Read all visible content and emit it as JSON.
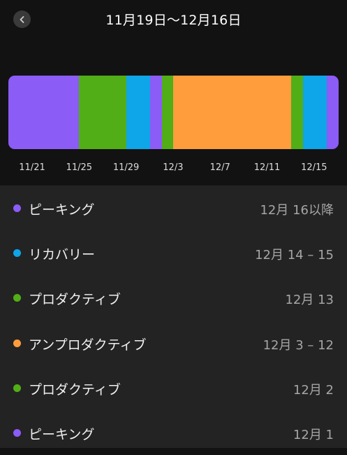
{
  "header": {
    "title": "11月19日～12月16日",
    "back_icon": "chevron-left-icon"
  },
  "colors": {
    "peaking": "#8b5cf6",
    "recovery": "#0ea5e9",
    "productive": "#52ae16",
    "unproductive": "#ff9d3d"
  },
  "timeline": {
    "segments": [
      {
        "state": "ピーキング",
        "color": "#8b5cf6",
        "days": 4.5
      },
      {
        "state": "プロダクティブ",
        "color": "#52ae16",
        "days": 3
      },
      {
        "state": "リカバリー",
        "color": "#0ea5e9",
        "days": 1.5
      },
      {
        "state": "ピーキング",
        "color": "#8b5cf6",
        "days": 0.75
      },
      {
        "state": "プロダクティブ",
        "color": "#52ae16",
        "days": 0.75
      },
      {
        "state": "アンプロダクティブ",
        "color": "#ff9d3d",
        "days": 7.5
      },
      {
        "state": "プロダクティブ",
        "color": "#52ae16",
        "days": 0.75
      },
      {
        "state": "リカバリー",
        "color": "#0ea5e9",
        "days": 1.5
      },
      {
        "state": "ピーキング",
        "color": "#8b5cf6",
        "days": 0.75
      }
    ],
    "axis_labels": [
      "11/21",
      "11/25",
      "11/29",
      "12/3",
      "12/7",
      "12/11",
      "12/15"
    ]
  },
  "list": [
    {
      "label": "ピーキング",
      "date": "12月 16以降",
      "color": "#8b5cf6"
    },
    {
      "label": "リカバリー",
      "date": "12月 14 – 15",
      "color": "#0ea5e9"
    },
    {
      "label": "プロダクティブ",
      "date": "12月 13",
      "color": "#52ae16"
    },
    {
      "label": "アンプロダクティブ",
      "date": "12月 3 – 12",
      "color": "#ff9d3d"
    },
    {
      "label": "プロダクティブ",
      "date": "12月 2",
      "color": "#52ae16"
    },
    {
      "label": "ピーキング",
      "date": "12月 1",
      "color": "#8b5cf6"
    }
  ]
}
